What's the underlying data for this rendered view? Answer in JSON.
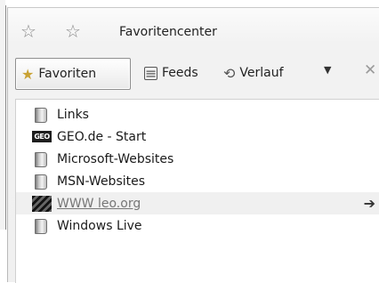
{
  "header": {
    "title": "Favoritencenter"
  },
  "tabs": [
    {
      "label": "Favoriten",
      "icon": "star-icon",
      "active": true
    },
    {
      "label": "Feeds",
      "icon": "feed-icon",
      "active": false
    },
    {
      "label": "Verlauf",
      "icon": "history-icon",
      "active": false
    }
  ],
  "list": {
    "items": [
      {
        "label": "Links",
        "icon": "folder-icon"
      },
      {
        "label": "GEO.de - Start",
        "icon": "geo-favicon",
        "badge_text": "GEO"
      },
      {
        "label": "Microsoft-Websites",
        "icon": "folder-icon"
      },
      {
        "label": "MSN-Websites",
        "icon": "folder-icon"
      },
      {
        "label": "WWW leo.org",
        "icon": "leo-favicon",
        "hovered": true
      },
      {
        "label": "Windows Live",
        "icon": "folder-icon"
      }
    ]
  },
  "colors": {
    "star_active": "#c9a233",
    "hover_row": "#f0f0f0"
  }
}
